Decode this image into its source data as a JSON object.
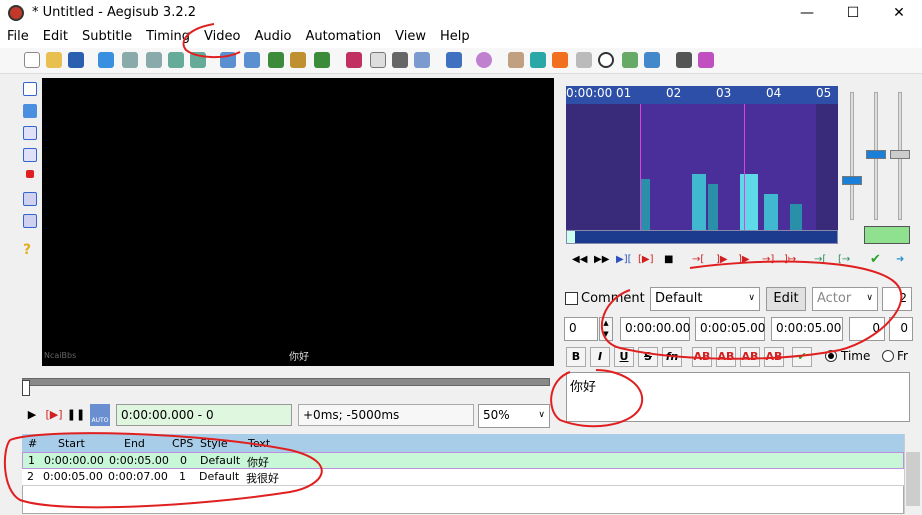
{
  "window": {
    "title": "* Untitled - Aegisub 3.2.2",
    "minimize": "—",
    "maximize": "☐",
    "close": "✕"
  },
  "menu": [
    "File",
    "Edit",
    "Subtitle",
    "Timing",
    "Video",
    "Audio",
    "Automation",
    "View",
    "Help"
  ],
  "video": {
    "subtitle_overlay": "你好",
    "watermark": "NcaiBbs"
  },
  "playback": {
    "time_display": "0:00:00.000 - 0",
    "offset_display": "+0ms; -5000ms",
    "zoom": "50%",
    "auto_label": "AUTO"
  },
  "audio": {
    "ticks": [
      "0:00:00",
      "01",
      "02",
      "03",
      "04",
      "05"
    ]
  },
  "edit": {
    "comment_label": "Comment",
    "style": "Default",
    "edit_button": "Edit",
    "actor_placeholder": "Actor",
    "margin_effect": "2",
    "layer": "0",
    "start": "0:00:00.00",
    "end": "0:00:05.00",
    "duration": "0:00:05.00",
    "margin_l": "0",
    "margin_r": "0",
    "time_label": "Time",
    "frame_label": "Fr",
    "text": "你好"
  },
  "grid": {
    "headers": [
      "#",
      "Start",
      "End",
      "CPS",
      "Style",
      "Text"
    ],
    "rows": [
      {
        "num": "1",
        "start": "0:00:00.00",
        "end": "0:00:05.00",
        "cps": "0",
        "style": "Default",
        "text": "你好"
      },
      {
        "num": "2",
        "start": "0:00:05.00",
        "end": "0:00:07.00",
        "cps": "1",
        "style": "Default",
        "text": "我很好"
      }
    ]
  },
  "colors": {
    "annotation": "#e02020",
    "spectrogram_bg": "#3a2b7a",
    "time_ok": "#dff7df",
    "grid_header": "#a8cde8"
  }
}
